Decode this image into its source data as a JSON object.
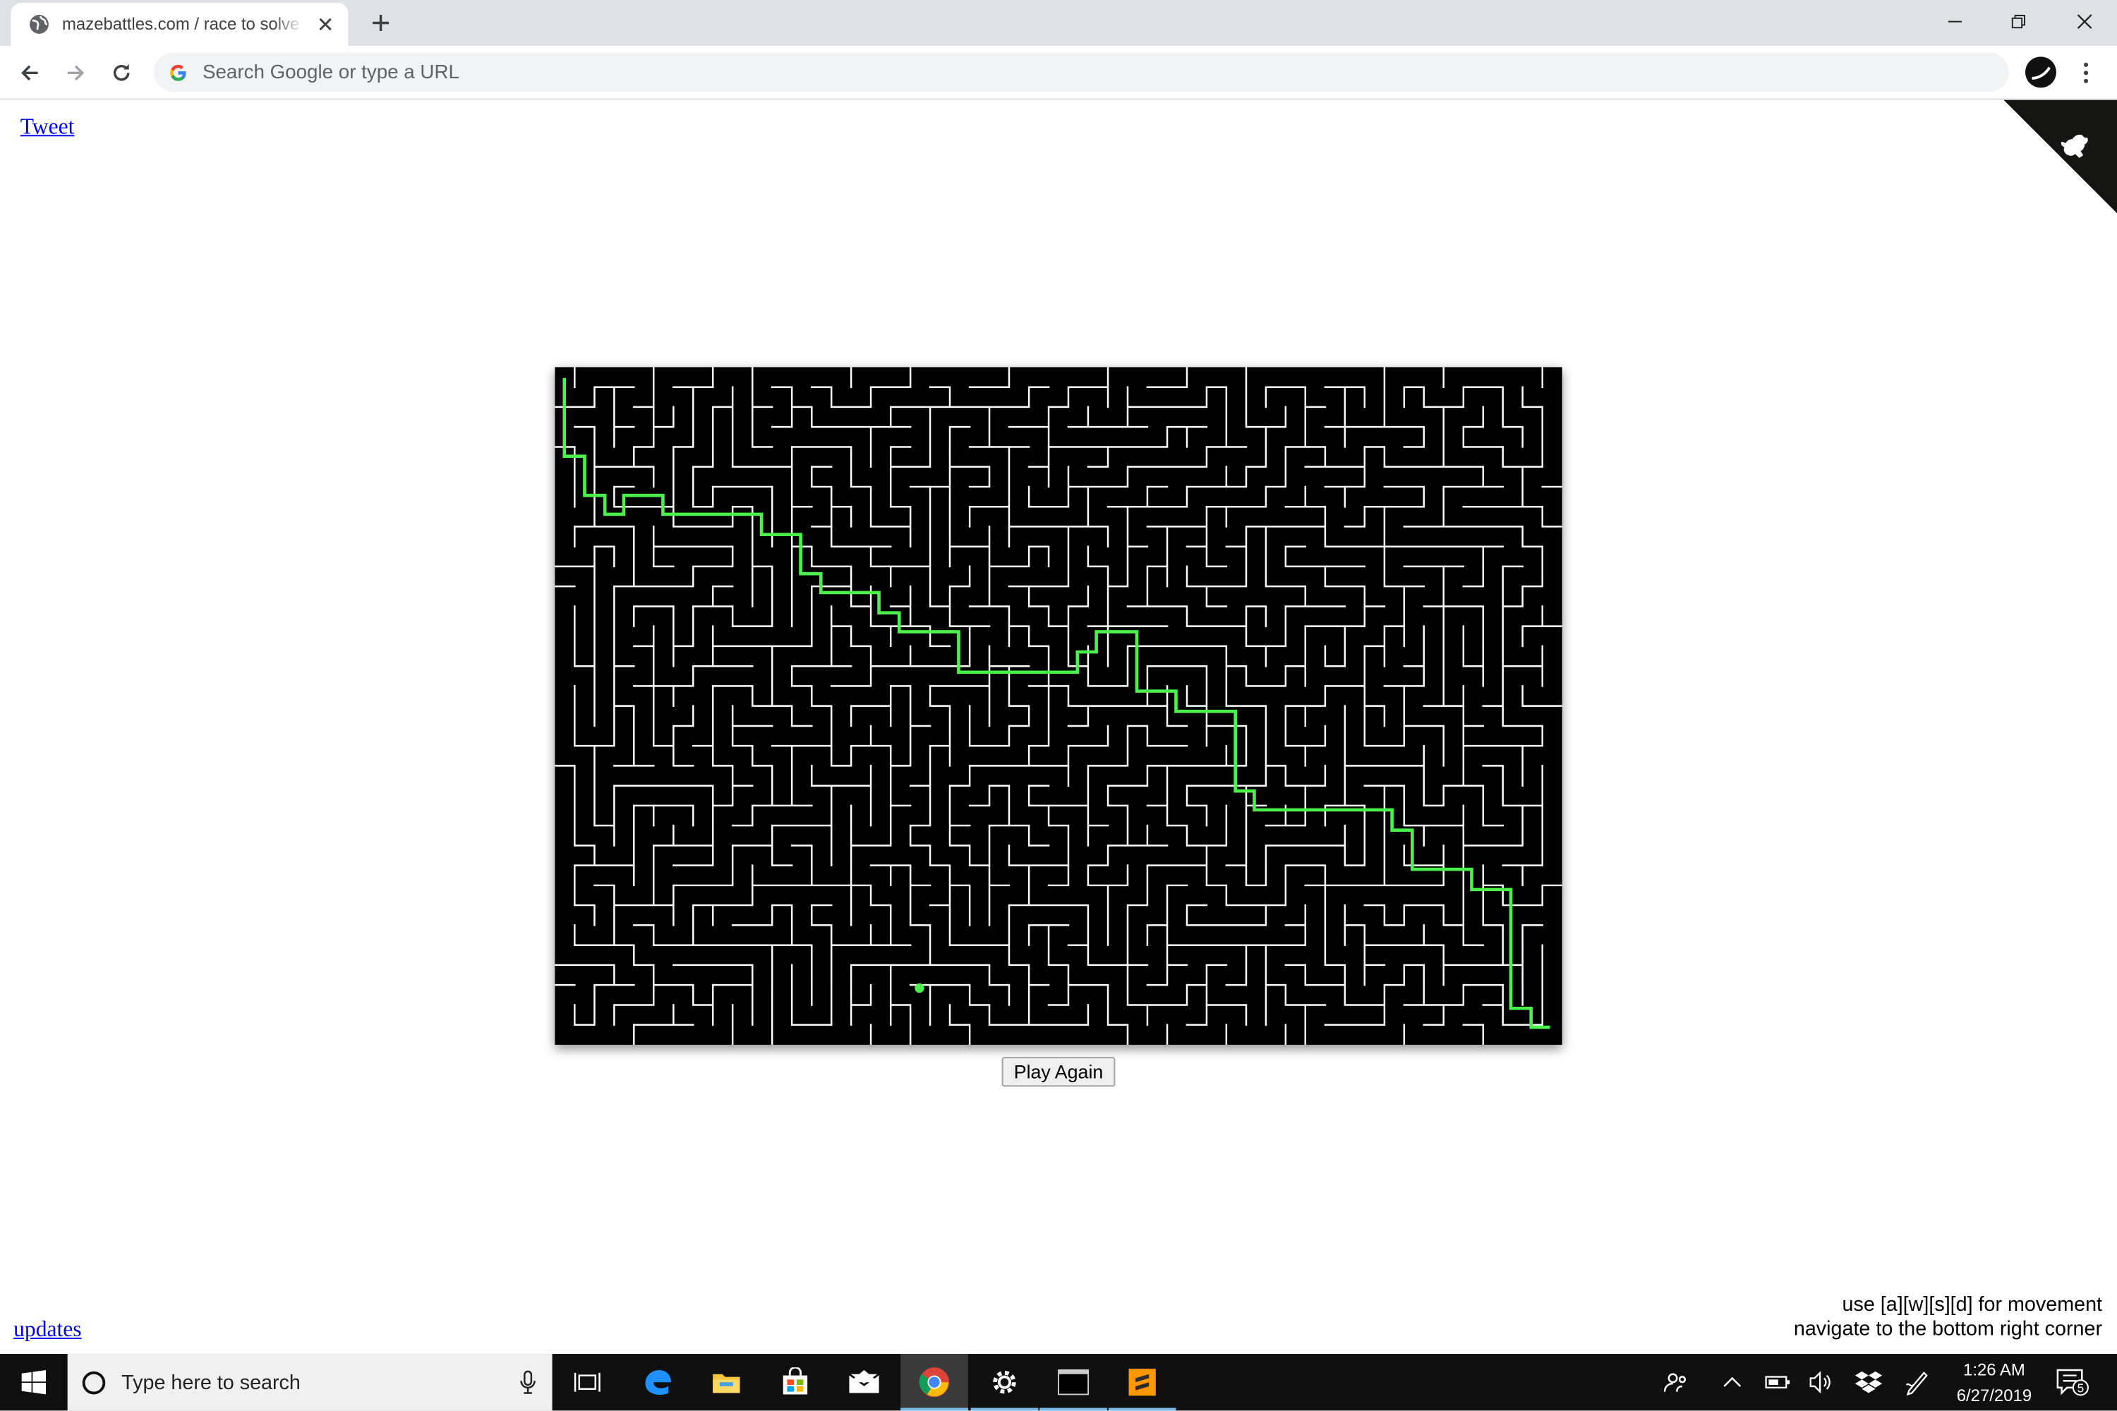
{
  "browser": {
    "tab_title": "mazebattles.com / race to solve mazes",
    "omnibox_placeholder": "Search Google or type a URL"
  },
  "page": {
    "tweet_link": "Tweet",
    "updates_link": "updates",
    "play_again_label": "Play Again",
    "instructions": [
      "use [a][w][s][d] for movement",
      "navigate to the bottom right corner"
    ]
  },
  "maze": {
    "cols": 51,
    "rows": 34,
    "wall_color": "#ffffff",
    "background_color": "#000000",
    "solution_color": "#4cf24c",
    "marker_color": "#4cf24c",
    "goal": "bottom-right corner"
  },
  "taskbar": {
    "search_placeholder": "Type here to search",
    "apps": [
      "task-view",
      "edge",
      "file-explorer",
      "store",
      "mail",
      "chrome",
      "settings",
      "terminal",
      "sublime-text"
    ],
    "time": "1:26 AM",
    "date": "6/27/2019",
    "notification_count": "5"
  },
  "colors": {
    "tabstrip": "#dee1e6",
    "taskbar": "#101010",
    "link": "#0000ee"
  }
}
